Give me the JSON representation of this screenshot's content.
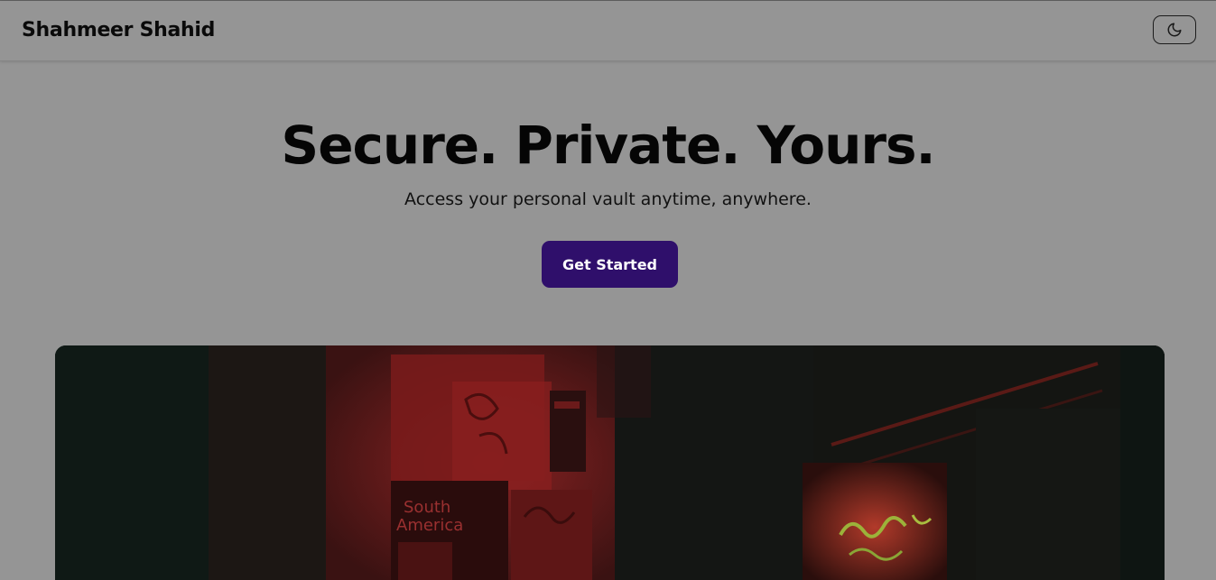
{
  "navbar": {
    "brand": "Shahmeer Shahid",
    "theme_toggle_icon": "moon-icon"
  },
  "hero": {
    "title": "Secure. Private. Yours.",
    "subtitle": "Access your personal vault anytime, anywhere.",
    "cta_label": "Get Started"
  },
  "image": {
    "poster_lines": [
      "South",
      "America"
    ]
  },
  "colors": {
    "page_background": "#959595",
    "cta_background": "#2f0f6b",
    "cta_text": "#ffffff",
    "text": "#050505"
  }
}
